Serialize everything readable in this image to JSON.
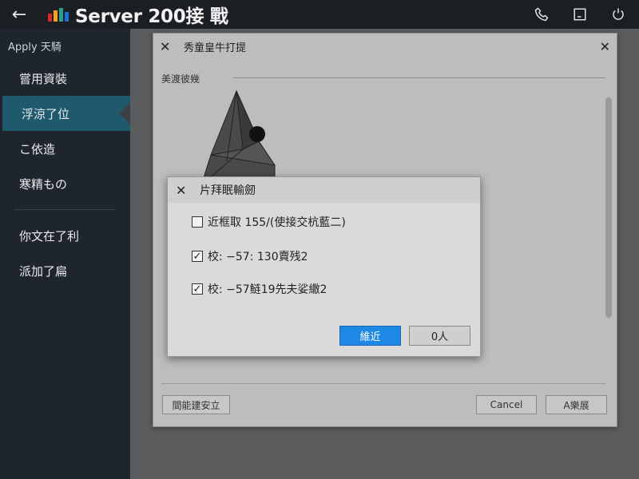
{
  "app": {
    "title": "Server 200接 戰",
    "logo_colors": [
      "#d62828",
      "#f4a11b",
      "#2a9d8f",
      "#1e6fd9"
    ]
  },
  "topbar": {
    "back_icon": "arrow-left-icon",
    "icons": [
      "phone-icon",
      "window-icon",
      "power-icon"
    ]
  },
  "sidebar": {
    "header": "Apply 天騎",
    "items": [
      {
        "label": "嘗用資裝"
      },
      {
        "label": "浮涼了位",
        "active": true
      },
      {
        "label": "こ依造"
      },
      {
        "label": "寒精もの"
      },
      {
        "label": "你文在了利"
      },
      {
        "label": "派加了扁"
      }
    ]
  },
  "panel": {
    "title": "秀童皇牛打提",
    "section_label": "美渡彼幾",
    "left_button": "間能建安立",
    "cancel": "Cancel",
    "apply": "A樂展"
  },
  "dialog": {
    "title": "片拜眠輸劒",
    "options": [
      {
        "label": "近框取 155/(使接交杭藍二)",
        "checked": false
      },
      {
        "label": "校: −57: 130賣残2",
        "checked": true
      },
      {
        "label": "校: −57鲢19先夫娑繖2",
        "checked": true
      }
    ],
    "ok": "維近",
    "cancel": "0人"
  }
}
